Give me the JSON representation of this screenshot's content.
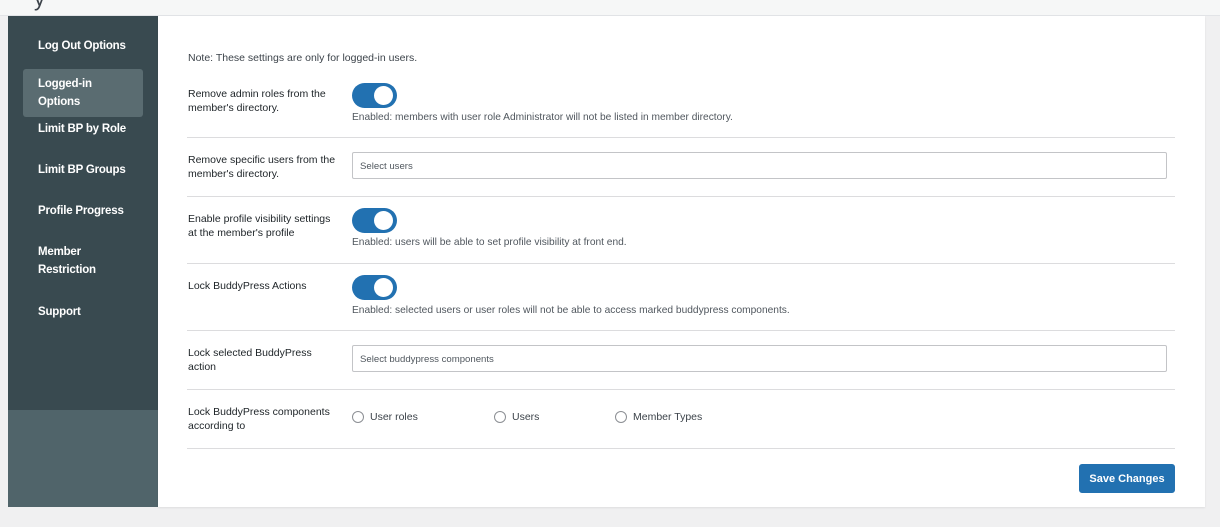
{
  "header": {
    "title_fragment": "y"
  },
  "sidebar": {
    "items": [
      {
        "label": "Log Out Options"
      },
      {
        "label": "Logged-in Options",
        "active": true
      },
      {
        "label": "Limit BP by Role"
      },
      {
        "label": "Limit BP Groups"
      },
      {
        "label": "Profile Progress"
      },
      {
        "label": "Member Restriction"
      },
      {
        "label": "Support"
      }
    ]
  },
  "main": {
    "note": "Note: These settings are only for logged-in users.",
    "settings": {
      "remove_admin": {
        "label": "Remove admin roles from the member's directory.",
        "enabled": true,
        "description": "Enabled: members with user role Administrator will not be listed in member directory."
      },
      "remove_users": {
        "label": "Remove specific users from the member's directory.",
        "placeholder": "Select users"
      },
      "profile_visibility": {
        "label": "Enable profile visibility settings at the member's profile",
        "enabled": true,
        "description": "Enabled: users will be able to set profile visibility at front end."
      },
      "lock_actions": {
        "label": "Lock BuddyPress Actions",
        "enabled": true,
        "description": "Enabled: selected users or user roles will not be able to access marked buddypress components."
      },
      "lock_selected": {
        "label": "Lock selected BuddyPress action",
        "placeholder": "Select buddypress components"
      },
      "lock_according": {
        "label": "Lock BuddyPress components according to",
        "options": [
          "User roles",
          "Users",
          "Member Types"
        ]
      }
    },
    "save_label": "Save Changes"
  },
  "colors": {
    "accent": "#2271b1",
    "sidebar": "#394a50",
    "sidebar_active": "#5a6c71"
  }
}
